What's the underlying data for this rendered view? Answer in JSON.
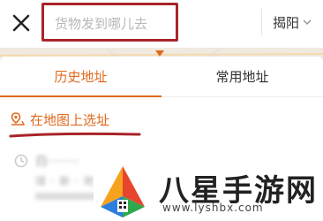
{
  "header": {
    "close_icon": "close-icon",
    "search_placeholder": "货物发到哪儿去",
    "city": "揭阳",
    "city_chevron_icon": "chevron-down-icon"
  },
  "tabs": [
    {
      "label": "历史地址",
      "active": true
    },
    {
      "label": "常用地址",
      "active": false
    }
  ],
  "pick_on_map": {
    "icon": "map-pin-icon",
    "label": "在地图上选址"
  },
  "history": [
    {
      "name": "白········",
      "address": "球 ·· 新 ·· 地 ····",
      "icon": "clock-icon"
    }
  ],
  "watermark": {
    "brand": "八星手游网",
    "url": "www.lyshbx.com"
  },
  "colors": {
    "accent": "#e06a1d",
    "highlight_border": "#a8242a"
  }
}
